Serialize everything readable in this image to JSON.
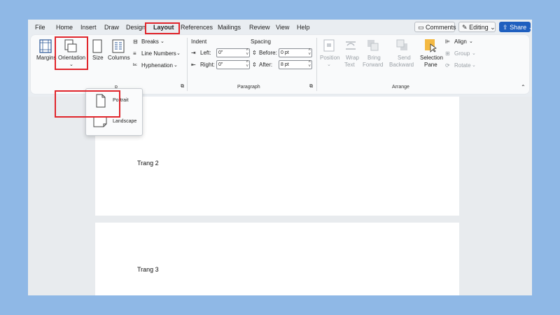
{
  "menu": {
    "tabs": [
      "File",
      "Home",
      "Insert",
      "Draw",
      "Design",
      "Layout",
      "References",
      "Mailings",
      "Review",
      "View",
      "Help"
    ],
    "active_tab": "Layout",
    "comments_label": "Comments",
    "editing_label": "Editing",
    "share_label": "Share"
  },
  "ribbon": {
    "page_setup": {
      "margins": "Margins",
      "orientation": "Orientation",
      "size": "Size",
      "columns": "Columns",
      "breaks": "Breaks",
      "line_numbers": "Line Numbers",
      "hyphenation": "Hyphenation",
      "group_label_fragment": "p"
    },
    "paragraph": {
      "indent_label": "Indent",
      "spacing_label": "Spacing",
      "left_label": "Left:",
      "left_value": "0\"",
      "right_label": "Right:",
      "right_value": "0\"",
      "before_label": "Before:",
      "before_value": "0 pt",
      "after_label": "After:",
      "after_value": "8 pt",
      "group_label": "Paragraph"
    },
    "arrange": {
      "position": "Position",
      "wrap_text_1": "Wrap",
      "wrap_text_2": "Text",
      "bring_forward_1": "Bring",
      "bring_forward_2": "Forward",
      "send_backward_1": "Send",
      "send_backward_2": "Backward",
      "selection_pane_1": "Selection",
      "selection_pane_2": "Pane",
      "align": "Align",
      "group": "Group",
      "rotate": "Rotate",
      "group_label": "Arrange"
    }
  },
  "orientation_menu": {
    "portrait": "Portrait",
    "landscape": "Landscape"
  },
  "document": {
    "page2_text": "Trang 2",
    "page3_text": "Trang 3"
  },
  "colors": {
    "background": "#8fb8e6",
    "highlight": "#e0252b",
    "share_button": "#1f5fbf"
  }
}
